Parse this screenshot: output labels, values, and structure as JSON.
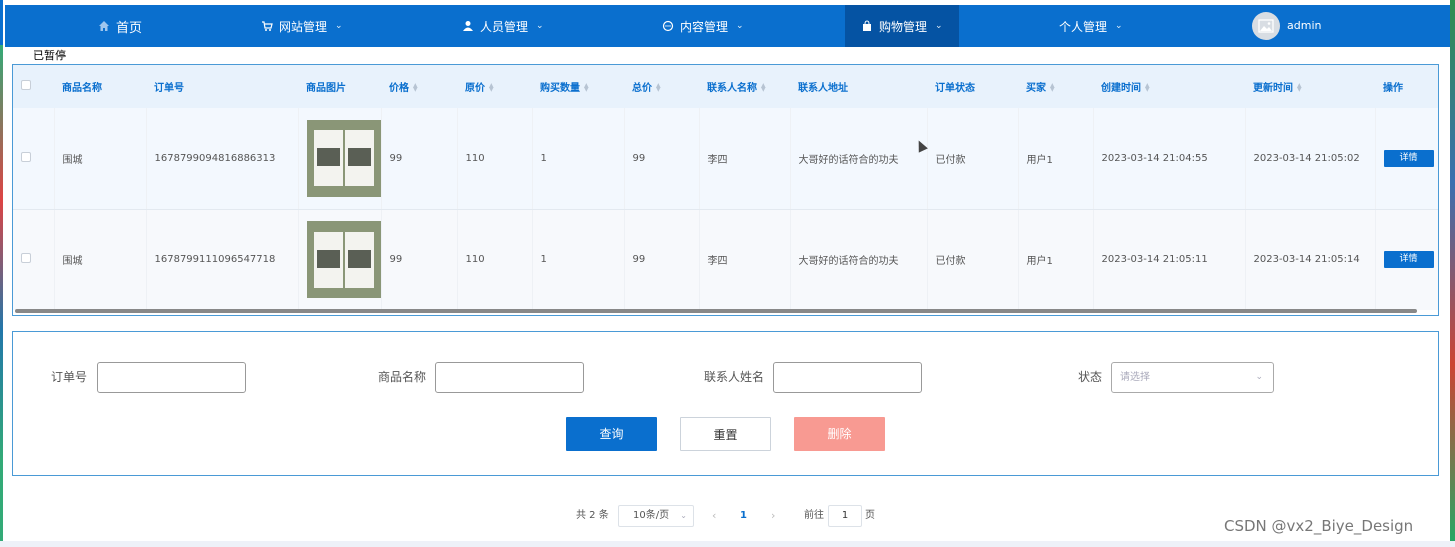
{
  "nav": {
    "home": "首页",
    "items": [
      {
        "label": "网站管理"
      },
      {
        "label": "人员管理"
      },
      {
        "label": "内容管理"
      },
      {
        "label": "购物管理"
      },
      {
        "label": "个人管理"
      }
    ],
    "username": "admin"
  },
  "status_tag": "已暂停",
  "table": {
    "headers": [
      "商品名称",
      "订单号",
      "商品图片",
      "价格",
      "原价",
      "购买数量",
      "总价",
      "联系人名称",
      "联系人地址",
      "订单状态",
      "买家",
      "创建时间",
      "更新时间",
      "操作"
    ],
    "rows": [
      {
        "name": "围城",
        "order_no": "1678799094816886313",
        "price": "99",
        "original_price": "110",
        "quantity": "1",
        "total": "99",
        "contact_name": "李四",
        "contact_address": "大哥好的话符合的功夫",
        "status": "已付款",
        "buyer": "用户1",
        "created": "2023-03-14 21:04:55",
        "updated": "2023-03-14 21:05:02",
        "action": "详情"
      },
      {
        "name": "围城",
        "order_no": "1678799111096547718",
        "price": "99",
        "original_price": "110",
        "quantity": "1",
        "total": "99",
        "contact_name": "李四",
        "contact_address": "大哥好的话符合的功夫",
        "status": "已付款",
        "buyer": "用户1",
        "created": "2023-03-14 21:05:11",
        "updated": "2023-03-14 21:05:14",
        "action": "详情"
      }
    ]
  },
  "search": {
    "order_no_label": "订单号",
    "order_no_value": "",
    "product_name_label": "商品名称",
    "product_name_value": "",
    "contact_label": "联系人姓名",
    "contact_value": "",
    "status_label": "状态",
    "status_placeholder": "请选择",
    "query_button": "查询",
    "reset_button": "重置",
    "delete_button": "删除"
  },
  "pagination": {
    "total_text": "共 2 条",
    "page_size": "10条/页",
    "current_page": "1",
    "goto_label": "前往",
    "goto_value": "1",
    "page_suffix": "页"
  },
  "watermark": "CSDN @vx2_Biye_Design"
}
